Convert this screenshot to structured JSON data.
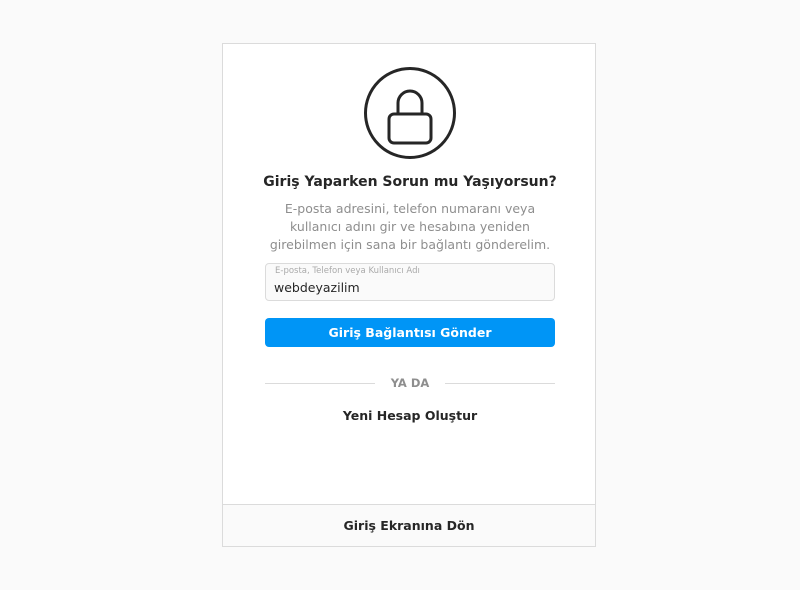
{
  "card": {
    "lock_icon": "lock-icon",
    "title": "Giriş Yaparken Sorun mu Yaşıyorsun?",
    "description": "E-posta adresini, telefon numaranı veya kullanıcı adını gir ve hesabına yeniden girebilmen için sana bir bağlantı gönderelim.",
    "field": {
      "label": "E-posta, Telefon veya Kullanıcı Adı",
      "value": "webdeyazilim"
    },
    "send_button_label": "Giriş Bağlantısı Gönder",
    "divider_text": "YA DA",
    "create_account_label": "Yeni Hesap Oluştur",
    "footer_label": "Giriş Ekranına Dön"
  },
  "colors": {
    "accent": "#0095f6",
    "page_bg": "#fafafa",
    "border": "#dbdbdb",
    "muted_text": "#8e8e8e",
    "text": "#262626"
  }
}
